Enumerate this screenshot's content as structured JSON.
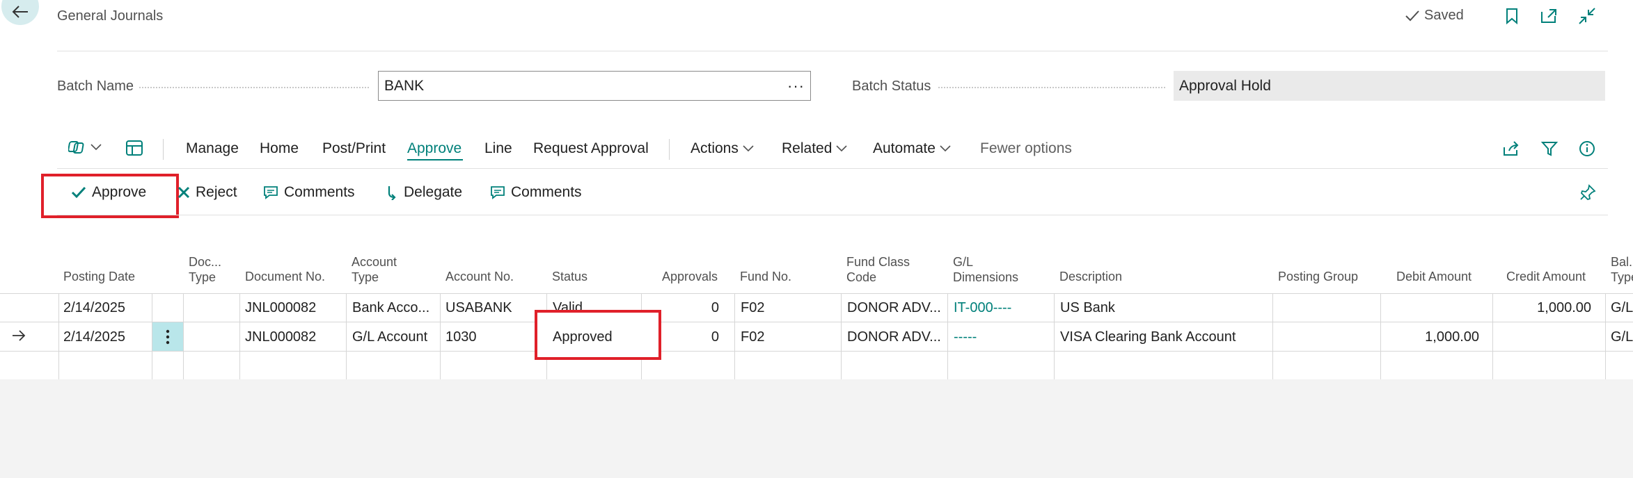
{
  "header": {
    "title": "General Journals",
    "saved_label": "Saved"
  },
  "fields": {
    "batch_name_label": "Batch Name",
    "batch_name_value": "BANK",
    "batch_status_label": "Batch Status",
    "batch_status_value": "Approval Hold"
  },
  "menu": {
    "manage": "Manage",
    "home": "Home",
    "post_print": "Post/Print",
    "approve": "Approve",
    "line": "Line",
    "request_approval": "Request Approval",
    "actions": "Actions",
    "related": "Related",
    "automate": "Automate",
    "fewer_options": "Fewer options"
  },
  "subactions": {
    "approve": "Approve",
    "reject": "Reject",
    "comments1": "Comments",
    "delegate": "Delegate",
    "comments2": "Comments"
  },
  "columns": {
    "posting_date": "Posting Date",
    "doc_type_1": "Doc...",
    "doc_type_2": "Type",
    "document_no": "Document No.",
    "account_type_1": "Account",
    "account_type_2": "Type",
    "account_no": "Account No.",
    "status": "Status",
    "approvals": "Approvals",
    "fund_no": "Fund No.",
    "fund_class_1": "Fund Class",
    "fund_class_2": "Code",
    "gl_dim_1": "G/L",
    "gl_dim_2": "Dimensions",
    "description": "Description",
    "posting_group": "Posting Group",
    "debit_amount": "Debit Amount",
    "credit_amount": "Credit Amount",
    "bal_1": "Bal.",
    "bal_2": "Type"
  },
  "rows": [
    {
      "posting_date": "2/14/2025",
      "document_no": "JNL000082",
      "account_type": "Bank Acco...",
      "account_no": "USABANK",
      "status": "Valid",
      "approvals": "0",
      "fund_no": "F02",
      "fund_class": "DONOR ADV...",
      "gl_dimensions": "IT-000----",
      "description": "US Bank",
      "debit_amount": "",
      "credit_amount": "1,000.00",
      "bal_type": "G/L"
    },
    {
      "posting_date": "2/14/2025",
      "document_no": "JNL000082",
      "account_type": "G/L Account",
      "account_no": "1030",
      "status": "Approved",
      "approvals": "0",
      "fund_no": "F02",
      "fund_class": "DONOR ADV...",
      "gl_dimensions": "-----",
      "description": "VISA Clearing Bank Account",
      "debit_amount": "1,000.00",
      "credit_amount": "",
      "bal_type": "G/L"
    }
  ],
  "colors": {
    "accent": "#00807a",
    "highlight": "#e0202a",
    "selected_cell": "#b9e6ea"
  },
  "icons": [
    "back-arrow-icon",
    "checkmark-icon",
    "bookmark-icon",
    "open-new-window-icon",
    "collapse-icon",
    "copilot-icon",
    "chevron-down-icon",
    "layout-icon",
    "share-icon",
    "filter-icon",
    "info-icon",
    "approve-check-icon",
    "reject-x-icon",
    "comment-icon",
    "delegate-arrow-icon",
    "pin-icon",
    "row-arrow-icon",
    "kebab-menu-icon"
  ]
}
